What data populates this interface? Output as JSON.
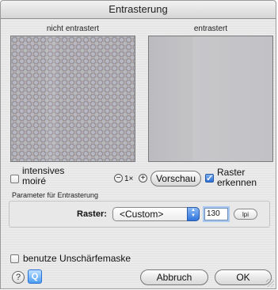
{
  "window": {
    "title": "Entrasterung"
  },
  "previews": {
    "left_caption": "nicht entrastert",
    "right_caption": "entrastert"
  },
  "controls": {
    "intensive_moire_label_line1": "intensives",
    "intensive_moire_label_line2": "moiré",
    "intensive_moire_checked": false,
    "zoom_out_glyph": "−",
    "zoom_level": "1×",
    "zoom_in_glyph": "+",
    "preview_button": "Vorschau",
    "detect_screen_label_line1": "Raster",
    "detect_screen_label_line2": "erkennen",
    "detect_screen_checked": true
  },
  "parameters": {
    "group_label": "Parameter für Entrasterung",
    "raster_label": "Raster:",
    "raster_value": "<Custom>",
    "raster_options": [
      "<Custom>"
    ],
    "frequency_value": "130",
    "unit_label": "lpi"
  },
  "footer": {
    "unsharp_mask_label": "benutze Unschärfemaske",
    "unsharp_mask_checked": false,
    "cancel_button": "Abbruch",
    "ok_button": "OK"
  },
  "icons": {
    "help": "help-icon",
    "info": "info-icon",
    "select_arrows": "up-down-arrows-icon",
    "zoom_out": "zoom-out-icon",
    "zoom_in": "zoom-in-icon",
    "resize": "resize-grip-icon"
  },
  "colors": {
    "accent": "#2a6fd6",
    "focus_ring": "#a8c8f0"
  }
}
